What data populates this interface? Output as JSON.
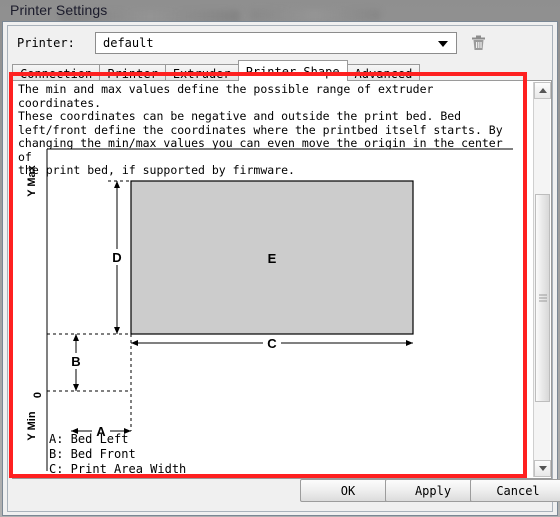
{
  "window": {
    "title": "Printer Settings"
  },
  "printer_row": {
    "label": "Printer:",
    "value": "default",
    "delete_icon": "trash-icon",
    "dropdown_icon": "chevron-down-icon"
  },
  "tabs": [
    {
      "label": "Connection",
      "active": false
    },
    {
      "label": "Printer",
      "active": false
    },
    {
      "label": "Extruder",
      "active": false
    },
    {
      "label": "Printer Shape",
      "active": true
    },
    {
      "label": "Advanced",
      "active": false
    }
  ],
  "content": {
    "description": "The min and max values define the possible range of extruder coordinates.\nThese coordinates can be negative and outside the print bed. Bed\nleft/front define the coordinates where the printbed itself starts. By\nchanging the min/max values you can even move the origin in the center of\nthe print bed, if supported by firmware.",
    "legend": "A: Bed Left\nB: Bed Front\nC: Print Area Width"
  },
  "diagram": {
    "y_max_label": "Y Max",
    "y_min_label": "Y Min",
    "origin_label": "0",
    "dimension_a": "A",
    "dimension_b": "B",
    "dimension_c": "C",
    "dimension_d": "D",
    "bed_label": "E",
    "bed_fill_color": "#cccccc",
    "bed_stroke_color": "#000000"
  },
  "scrollbar": {
    "up_icon": "triangle-up-icon",
    "down_icon": "triangle-down-icon"
  },
  "highlight": {
    "color": "#fe2020"
  },
  "buttons": {
    "ok": "OK",
    "apply": "Apply",
    "cancel": "Cancel"
  }
}
